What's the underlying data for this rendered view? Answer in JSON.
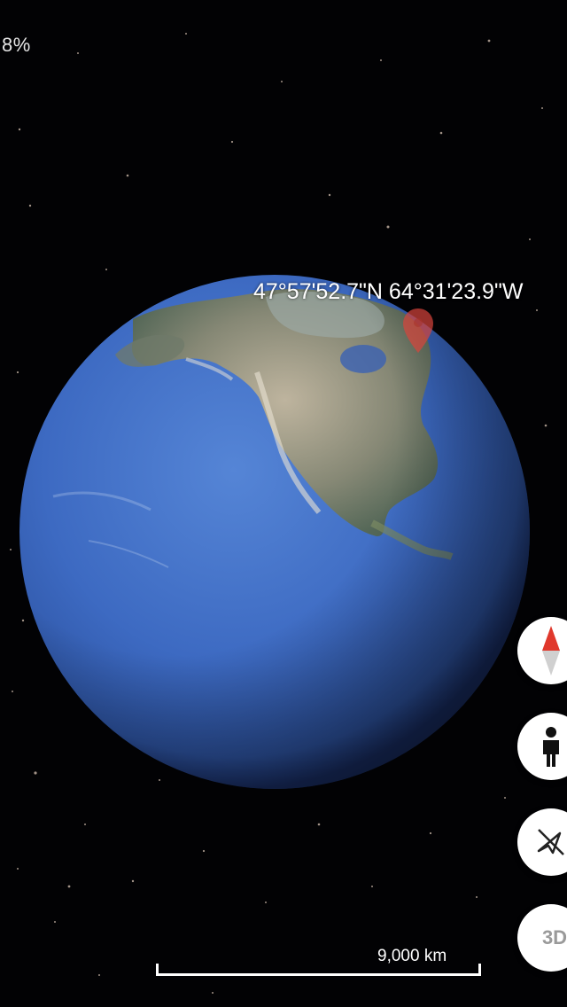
{
  "status": {
    "battery_text": "8%"
  },
  "map": {
    "coordinates": "47°57'52.7\"N 64°31'23.9\"W",
    "scale_label": "9,000 km"
  },
  "controls": {
    "compass_icon": "compass-icon",
    "street_view_icon": "pegman-icon",
    "camera_icon": "camera-off-icon",
    "view_3d_label": "3D"
  },
  "colors": {
    "space": "#020204",
    "ocean": "#3e6fc4",
    "marker": "#d8453c",
    "fab_bg": "#ffffff"
  }
}
